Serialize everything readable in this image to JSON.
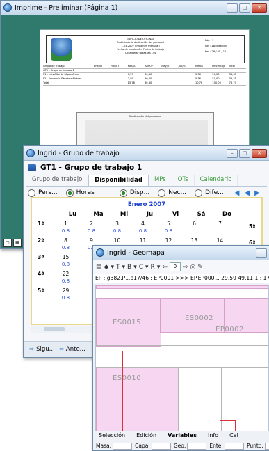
{
  "win1": {
    "title": "Imprime - Preliminar (Página 1)",
    "report": {
      "org": "EDIFICIO DE OFICINAS",
      "title": "Análisis de la dedicación del personal",
      "line1": "1-03-2007 (Imagines mensual)",
      "line2": "Fecha de emulación: Fecha de trabajo",
      "line3": "Considerar todas las OTs",
      "pag": "Pág : 1",
      "ref": "Ref : 1w.dotación",
      "fecha": "Fec : 28 / 05 / 11"
    },
    "table": {
      "headers": [
        "Grupo de trabajo",
        "Ene/07",
        "Feb/07",
        "Mar/07",
        "Abr/07",
        "May/07",
        "Jun/07",
        "Media",
        "Porcentaje",
        "Total"
      ],
      "rows": [
        [
          "GT1 - Grupo de trabajo 1",
          "",
          "",
          "",
          "",
          "",
          "",
          "",
          "",
          ""
        ],
        [
          "P1 - Luis Alberto López Arnar",
          "",
          "",
          "7,59",
          "30,40",
          "",
          "",
          "5,36",
          "50,00",
          "38,35"
        ],
        [
          "P2 - Fernando Sánchez Alcázar",
          "",
          "",
          "7,59",
          "30,40",
          "",
          "",
          "5,36",
          "50,00",
          "38,35"
        ],
        [
          "Total",
          "",
          "",
          "15,78",
          "60,80",
          "",
          "",
          "10,76",
          "100,00",
          "76,70"
        ]
      ]
    },
    "chart_title": "Dedicación del personal"
  },
  "win2": {
    "title": "Ingrid - Grupo de trabajo",
    "heading": "GT1 - Grupo de trabajo 1",
    "tabs": [
      "Grupo de trabajo",
      "Disponibilidad",
      "MPs",
      "OTs",
      "Calendario"
    ],
    "radios": {
      "pers": "Pers...",
      "horas": "Horas",
      "disp": "Disp...",
      "nec": "Nec...",
      "dife": "Dife..."
    },
    "month": "Enero 2007",
    "days": [
      "Lu",
      "Ma",
      "Mi",
      "Ju",
      "Vi",
      "Sá",
      "Do"
    ],
    "weeks": [
      {
        "wk": "1ª",
        "cells": [
          [
            "1",
            "0.8"
          ],
          [
            "2",
            "0.8"
          ],
          [
            "3",
            "0.8"
          ],
          [
            "4",
            "0.8"
          ],
          [
            "5",
            "0.8"
          ],
          [
            "6",
            ""
          ],
          [
            "7",
            ""
          ]
        ]
      },
      {
        "wk": "2ª",
        "cells": [
          [
            "8",
            "0.8"
          ],
          [
            "9",
            "0.8"
          ],
          [
            "10",
            "0.8"
          ],
          [
            "11",
            ""
          ],
          [
            "12",
            ""
          ],
          [
            "13",
            ""
          ],
          [
            "14",
            ""
          ]
        ]
      },
      {
        "wk": "3ª",
        "cells": [
          [
            "15",
            "0.8"
          ],
          [
            "",
            ""
          ],
          [
            "",
            ""
          ],
          [
            "",
            ""
          ],
          [
            "",
            ""
          ],
          [
            "",
            ""
          ],
          [
            "",
            ""
          ]
        ]
      },
      {
        "wk": "4ª",
        "cells": [
          [
            "22",
            "0.8"
          ],
          [
            "",
            ""
          ],
          [
            "",
            ""
          ],
          [
            "",
            ""
          ],
          [
            "",
            ""
          ],
          [
            "",
            ""
          ],
          [
            "",
            ""
          ]
        ]
      },
      {
        "wk": "5ª",
        "cells": [
          [
            "29",
            "0.8"
          ],
          [
            "",
            ""
          ],
          [
            "",
            ""
          ],
          [
            "",
            ""
          ],
          [
            "",
            ""
          ],
          [
            "",
            ""
          ],
          [
            "",
            ""
          ]
        ]
      }
    ],
    "right_weeks": [
      "5ª",
      "6ª"
    ],
    "footer": {
      "next": "Sigu...",
      "prev": "Ante..."
    }
  },
  "win3": {
    "title": "Ingrid - Geomapa",
    "toolbar": [
      "T",
      "B",
      "C",
      "R"
    ],
    "zoom_value": "0",
    "path": "EP : g382.P1.p17/46 : EP0001 >>> EP.EP000...  29.59  49.11  1 : 17",
    "rooms": [
      "ES0015",
      "ES0002",
      "EP0002",
      "ES0010"
    ],
    "tabs": [
      "Selección",
      "Edición",
      "Variables",
      "Info",
      "Cal"
    ],
    "fields": [
      "Masa:",
      "Capa:",
      "Geo:",
      "Ente:",
      "Punto:"
    ]
  }
}
